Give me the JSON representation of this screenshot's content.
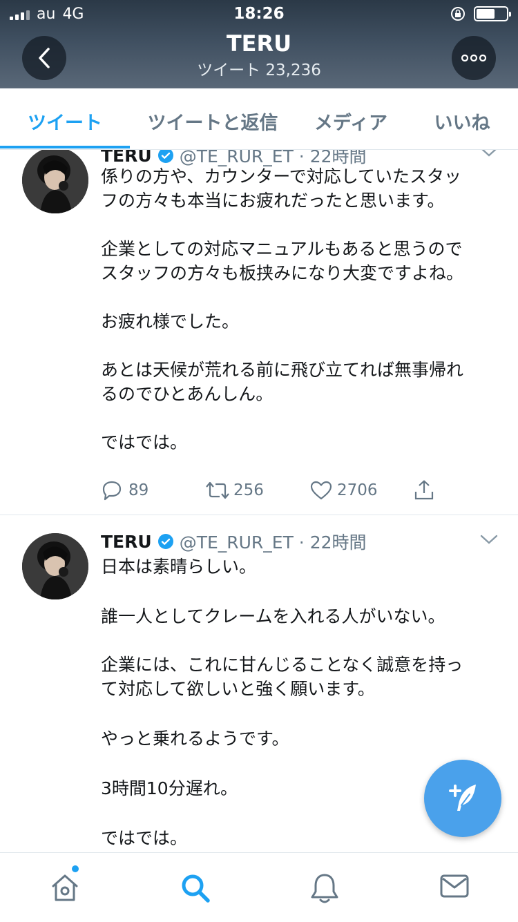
{
  "status_bar": {
    "carrier": "au",
    "network": "4G",
    "time": "18:26",
    "battery_level": 0.55
  },
  "header": {
    "title": "TERU",
    "subtitle": "ツイート 23,236",
    "back_icon": "chevron-left-icon",
    "more_icon": "more-dots-icon"
  },
  "tabs": [
    {
      "label": "ツイート",
      "active": true
    },
    {
      "label": "ツイートと返信",
      "active": false
    },
    {
      "label": "メディア",
      "active": false
    },
    {
      "label": "いいね",
      "active": false
    }
  ],
  "tweets": [
    {
      "name": "TERU",
      "handle": "@TE_RUR_ET · 22時間",
      "lines": [
        "係りの方や、カウンターで対応していたスタッ",
        "フの方々も本当にお疲れだったと思います。",
        "",
        "企業としての対応マニュアルもあると思うので",
        "スタッフの方々も板挟みになり大変ですよね。",
        "",
        "お疲れ様でした。",
        "",
        "あとは天候が荒れる前に飛び立てれば無事帰れ",
        "るのでひとあんしん。",
        "",
        "ではでは。"
      ],
      "replies": "89",
      "retweets": "256",
      "likes": "2706"
    },
    {
      "name": "TERU",
      "handle": "@TE_RUR_ET · 22時間",
      "lines": [
        "日本は素晴らしい。",
        "",
        "誰一人としてクレームを入れる人がいない。",
        "",
        "企業には、これに甘んじることなく誠意を持っ",
        "て対応して欲しいと強く願います。",
        "",
        "やっと乗れるようです。",
        "",
        "3時間10分遅れ。",
        "",
        "ではでは。"
      ]
    }
  ],
  "bottom_nav": [
    "home-icon",
    "search-icon",
    "notifications-icon",
    "messages-icon"
  ],
  "colors": {
    "accent": "#1da1f2",
    "fab": "#4aa1eb",
    "muted": "#657786"
  }
}
